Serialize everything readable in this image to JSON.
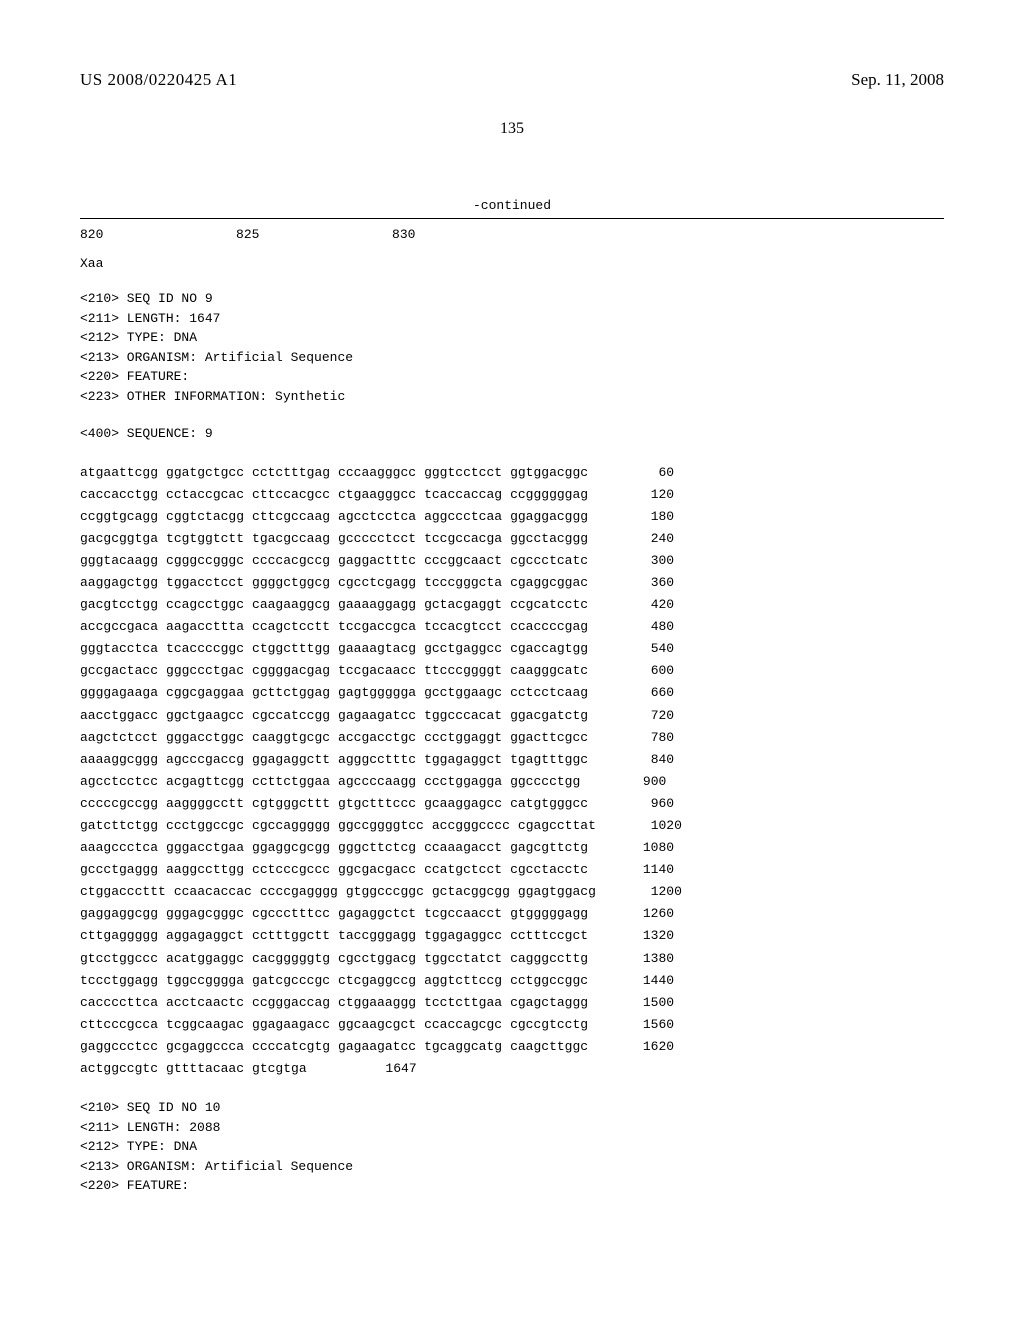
{
  "header": {
    "pub_number": "US 2008/0220425 A1",
    "pub_date": "Sep. 11, 2008"
  },
  "page_number": "135",
  "continued_label": "-continued",
  "top_positions": "820                 825                 830",
  "xaa": "Xaa",
  "seq9_meta": [
    "<210> SEQ ID NO 9",
    "<211> LENGTH: 1647",
    "<212> TYPE: DNA",
    "<213> ORGANISM: Artificial Sequence",
    "<220> FEATURE:",
    "<223> OTHER INFORMATION: Synthetic"
  ],
  "seq9_header": "<400> SEQUENCE: 9",
  "seq9_rows": [
    {
      "g": [
        "atgaattcgg",
        "ggatgctgcc",
        "cctctttgag",
        "cccaagggcc",
        "gggtcctcct",
        "ggtggacggc"
      ],
      "pos": "60"
    },
    {
      "g": [
        "caccacctgg",
        "cctaccgcac",
        "cttccacgcc",
        "ctgaagggcc",
        "tcaccaccag",
        "ccggggggag"
      ],
      "pos": "120"
    },
    {
      "g": [
        "ccggtgcagg",
        "cggtctacgg",
        "cttcgccaag",
        "agcctcctca",
        "aggccctcaa",
        "ggaggacggg"
      ],
      "pos": "180"
    },
    {
      "g": [
        "gacgcggtga",
        "tcgtggtctt",
        "tgacgccaag",
        "gccccctcct",
        "tccgccacga",
        "ggcctacggg"
      ],
      "pos": "240"
    },
    {
      "g": [
        "gggtacaagg",
        "cgggccgggc",
        "ccccacgccg",
        "gaggactttc",
        "cccggcaact",
        "cgccctcatc"
      ],
      "pos": "300"
    },
    {
      "g": [
        "aaggagctgg",
        "tggacctcct",
        "ggggctggcg",
        "cgcctcgagg",
        "tcccgggcta",
        "cgaggcggac"
      ],
      "pos": "360"
    },
    {
      "g": [
        "gacgtcctgg",
        "ccagcctggc",
        "caagaaggcg",
        "gaaaaggagg",
        "gctacgaggt",
        "ccgcatcctc"
      ],
      "pos": "420"
    },
    {
      "g": [
        "accgccgaca",
        "aagaccttta",
        "ccagctcctt",
        "tccgaccgca",
        "tccacgtcct",
        "ccaccccgag"
      ],
      "pos": "480"
    },
    {
      "g": [
        "gggtacctca",
        "tcaccccggc",
        "ctggctttgg",
        "gaaaagtacg",
        "gcctgaggcc",
        "cgaccagtgg"
      ],
      "pos": "540"
    },
    {
      "g": [
        "gccgactacc",
        "gggccctgac",
        "cggggacgag",
        "tccgacaacc",
        "ttcccggggt",
        "caagggcatc"
      ],
      "pos": "600"
    },
    {
      "g": [
        "ggggagaaga",
        "cggcgaggaa",
        "gcttctggag",
        "gagtggggga",
        "gcctggaagc",
        "cctcctcaag"
      ],
      "pos": "660"
    },
    {
      "g": [
        "aacctggacc",
        "ggctgaagcc",
        "cgccatccgg",
        "gagaagatcc",
        "tggcccacat",
        "ggacgatctg"
      ],
      "pos": "720"
    },
    {
      "g": [
        "aagctctcct",
        "gggacctggc",
        "caaggtgcgc",
        "accgacctgc",
        "ccctggaggt",
        "ggacttcgcc"
      ],
      "pos": "780"
    },
    {
      "g": [
        "aaaaggcggg",
        "agcccgaccg",
        "ggagaggctt",
        "agggcctttc",
        "tggagaggct",
        "tgagtttggc"
      ],
      "pos": "840"
    },
    {
      "g": [
        "agcctcctcc",
        "acgagttcgg",
        "ccttctggaa",
        "agccccaagg",
        "ccctggagga",
        "ggcccctgg"
      ],
      "pos": "900"
    },
    {
      "g": [
        "cccccgccgg",
        "aaggggcctt",
        "cgtgggcttt",
        "gtgctttccc",
        "gcaaggagcc",
        "catgtgggcc"
      ],
      "pos": "960"
    },
    {
      "g": [
        "gatcttctgg",
        "ccctggccgc",
        "cgccaggggg",
        "ggccggggtcc",
        "accgggcccc",
        "cgagccttat"
      ],
      "pos": "1020"
    },
    {
      "g": [
        "aaagccctca",
        "gggacctgaa",
        "ggaggcgcgg",
        "gggcttctcg",
        "ccaaagacct",
        "gagcgttctg"
      ],
      "pos": "1080"
    },
    {
      "g": [
        "gccctgaggg",
        "aaggccttgg",
        "cctcccgccc",
        "ggcgacgacc",
        "ccatgctcct",
        "cgcctacctc"
      ],
      "pos": "1140"
    },
    {
      "g": [
        "ctggacccttt",
        "ccaacaccac",
        "ccccgagggg",
        "gtggcccggc",
        "gctacggcgg",
        "ggagtggacg"
      ],
      "pos": "1200"
    },
    {
      "g": [
        "gaggaggcgg",
        "gggagcgggc",
        "cgccctttcc",
        "gagaggctct",
        "tcgccaacct",
        "gtgggggagg"
      ],
      "pos": "1260"
    },
    {
      "g": [
        "cttgaggggg",
        "aggagaggct",
        "cctttggctt",
        "taccgggagg",
        "tggagaggcc",
        "cctttccgct"
      ],
      "pos": "1320"
    },
    {
      "g": [
        "gtcctggccc",
        "acatggaggc",
        "cacgggggtg",
        "cgcctggacg",
        "tggcctatct",
        "cagggccttg"
      ],
      "pos": "1380"
    },
    {
      "g": [
        "tccctggagg",
        "tggccgggga",
        "gatcgcccgc",
        "ctcgaggccg",
        "aggtcttccg",
        "cctggccggc"
      ],
      "pos": "1440"
    },
    {
      "g": [
        "caccccttca",
        "acctcaactc",
        "ccgggaccag",
        "ctggaaaggg",
        "tcctcttgaa",
        "cgagctaggg"
      ],
      "pos": "1500"
    },
    {
      "g": [
        "cttcccgcca",
        "tcggcaagac",
        "ggagaagacc",
        "ggcaagcgct",
        "ccaccagcgc",
        "cgccgtcctg"
      ],
      "pos": "1560"
    },
    {
      "g": [
        "gaggccctcc",
        "gcgaggccca",
        "ccccatcgtg",
        "gagaagatcc",
        "tgcaggcatg",
        "caagcttggc"
      ],
      "pos": "1620"
    },
    {
      "g": [
        "actggccgtc",
        "gttttacaac",
        "gtcgtga",
        "",
        "",
        ""
      ],
      "pos": "1647"
    }
  ],
  "seq10_meta": [
    "<210> SEQ ID NO 10",
    "<211> LENGTH: 2088",
    "<212> TYPE: DNA",
    "<213> ORGANISM: Artificial Sequence",
    "<220> FEATURE:"
  ]
}
